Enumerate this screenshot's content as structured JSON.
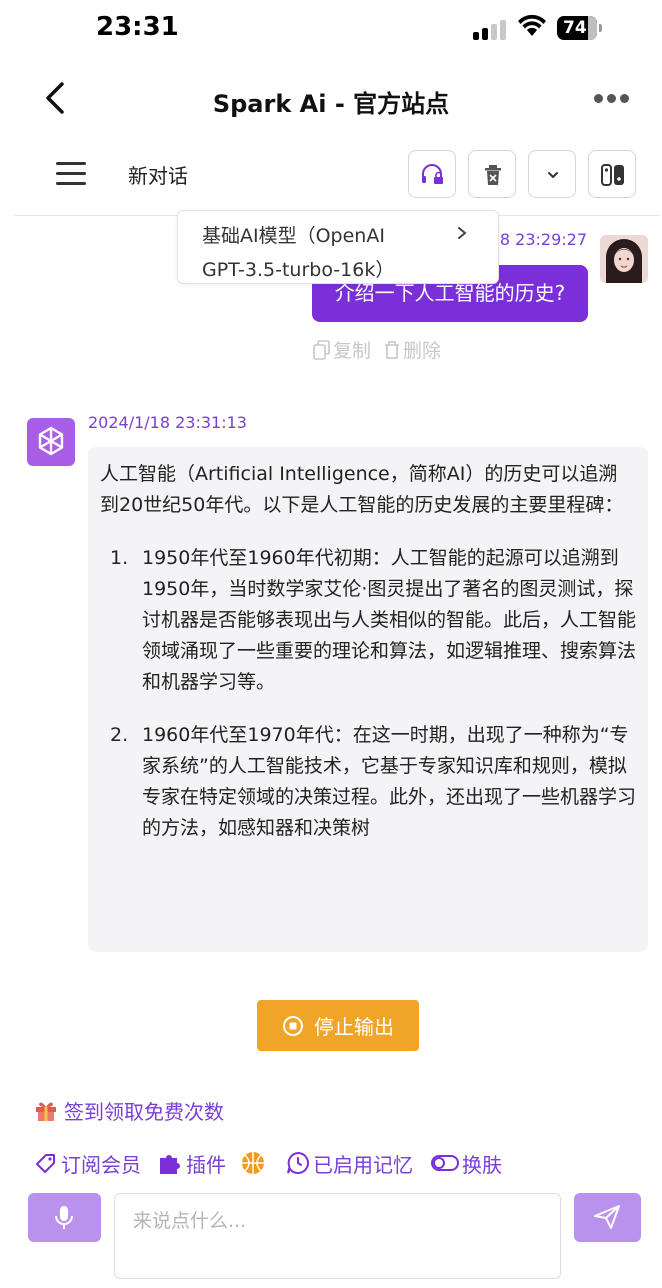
{
  "status_bar": {
    "time": "23:31",
    "battery": "74"
  },
  "nav": {
    "title": "Spark Ai - 官方站点"
  },
  "toolbar": {
    "chat_title": "新对话"
  },
  "model_dropdown": {
    "line1": "基础AI模型（OpenAI",
    "line2": "GPT-3.5-turbo-16k）"
  },
  "user_message": {
    "time": "8 23:29:27",
    "text": "介绍一下人工智能的历史?",
    "actions": {
      "copy": "复制",
      "delete": "删除"
    }
  },
  "bot_message": {
    "time": "2024/1/18 23:31:13",
    "intro": "人工智能（Artificial Intelligence，简称AI）的历史可以追溯到20世纪50年代。以下是人工智能的历史发展的主要里程碑：",
    "items": [
      {
        "num": "1.",
        "text": "1950年代至1960年代初期：人工智能的起源可以追溯到1950年，当时数学家艾伦·图灵提出了著名的图灵测试，探讨机器是否能够表现出与人类相似的智能。此后，人工智能领域涌现了一些重要的理论和算法，如逻辑推理、搜索算法和机器学习等。"
      },
      {
        "num": "2.",
        "text": "1960年代至1970年代：在这一时期，出现了一种称为“专家系统”的人工智能技术，它基于专家知识库和规则，模拟专家在特定领域的决策过程。此外，还出现了一些机器学习的方法，如感知器和决策树"
      }
    ]
  },
  "stop_button": {
    "label": "停止输出"
  },
  "checkin": {
    "label": "签到领取免费次数"
  },
  "features": {
    "subscribe": "订阅会员",
    "plugins": "插件",
    "memory": "已启用记忆",
    "skin": "换肤"
  },
  "input": {
    "placeholder": "来说点什么..."
  },
  "colors": {
    "accent": "#7b2fd9",
    "accent_light": "#b892ec",
    "stop": "#f0a428"
  }
}
